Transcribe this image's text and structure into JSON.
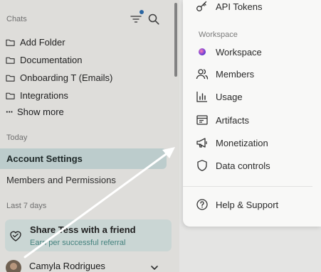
{
  "sidebar": {
    "chats_label": "Chats",
    "folders": [
      {
        "label": "Add Folder"
      },
      {
        "label": "Documentation"
      },
      {
        "label": "Onboarding T (Emails)"
      },
      {
        "label": "Integrations"
      }
    ],
    "show_more": "Show more",
    "today_label": "Today",
    "active_chat": "Account Settings",
    "chat_2": "Members and Permissions",
    "last7_label": "Last 7 days",
    "share_card": {
      "title": "Share Tess with a friend",
      "subtitle": "Earn per successful referral"
    },
    "user_name": "Camyla Rodrigues"
  },
  "menu": {
    "api_tokens": "API Tokens",
    "workspace_section": "Workspace",
    "items": [
      {
        "label": "Workspace",
        "icon": "workspace-logo-icon"
      },
      {
        "label": "Members",
        "icon": "members-icon"
      },
      {
        "label": "Usage",
        "icon": "usage-chart-icon"
      },
      {
        "label": "Artifacts",
        "icon": "artifacts-icon"
      },
      {
        "label": "Monetization",
        "icon": "megaphone-icon"
      },
      {
        "label": "Data controls",
        "icon": "shield-icon"
      }
    ],
    "help": "Help & Support"
  },
  "colors": {
    "active_item_bg": "#cfe1e1",
    "share_card_bg": "#dfecea",
    "filter_dot": "#2f6fb1"
  }
}
